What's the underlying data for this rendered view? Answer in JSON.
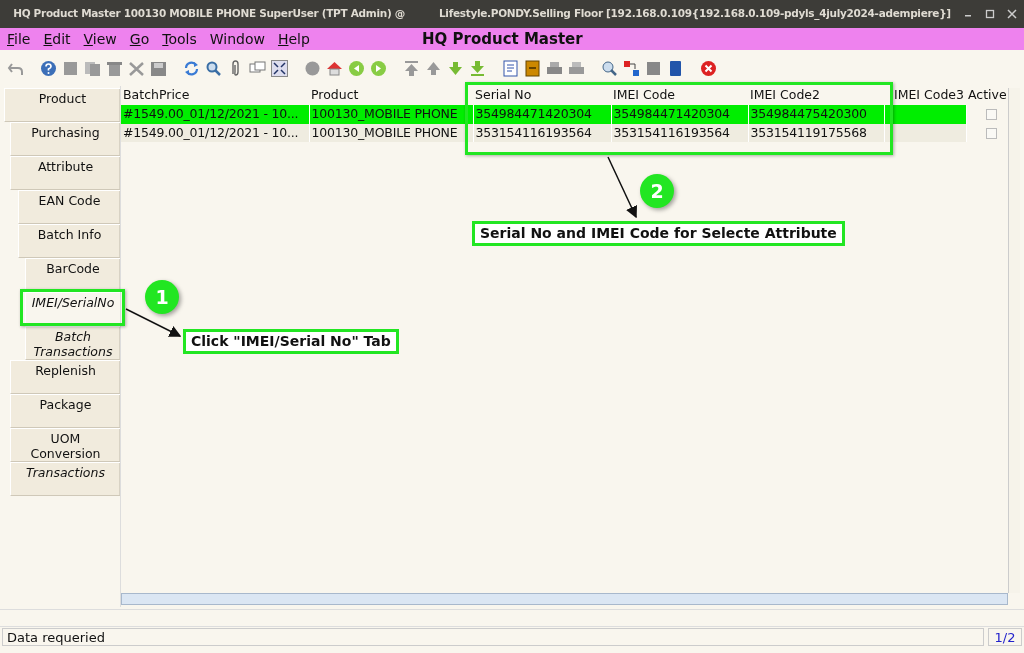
{
  "window": {
    "title_before": "HQ Product Master  100130  MOBILE PHONE  SuperUser (TPT Admin) @",
    "title_after": "Lifestyle.PONDY.Selling Floor [192.168.0.109{192.168.0.109-pdyls_4july2024-adempiere}]"
  },
  "menu": [
    {
      "label": "File",
      "mnemonic": true
    },
    {
      "label": "Edit",
      "mnemonic": true
    },
    {
      "label": "View",
      "mnemonic": true
    },
    {
      "label": "Go",
      "mnemonic": true
    },
    {
      "label": "Tools",
      "mnemonic": true
    },
    {
      "label": "Window",
      "mnemonic": false
    },
    {
      "label": "Help",
      "mnemonic": true
    }
  ],
  "menu_title": "HQ Product Master",
  "tabs": [
    {
      "label": "Product",
      "selected": false,
      "read_only": false,
      "children": [
        {
          "label": "Purchasing",
          "selected": false,
          "read_only": false
        },
        {
          "label": "Attribute",
          "selected": false,
          "read_only": false,
          "children": [
            {
              "label": "EAN Code",
              "selected": false,
              "read_only": false
            },
            {
              "label": "Batch Info",
              "selected": false,
              "read_only": false,
              "children": [
                {
                  "label": "BarCode",
                  "selected": false,
                  "read_only": false
                },
                {
                  "label": "IMEI/SerialNo",
                  "selected": true,
                  "read_only": true
                },
                {
                  "label": "Batch Transactions",
                  "selected": false,
                  "read_only": true
                }
              ]
            }
          ]
        },
        {
          "label": "Replenish",
          "selected": false,
          "read_only": false
        },
        {
          "label": "Package",
          "selected": false,
          "read_only": false
        },
        {
          "label": "UOM Conversion",
          "selected": false,
          "read_only": false
        },
        {
          "label": "Transactions",
          "selected": false,
          "read_only": true
        }
      ]
    }
  ],
  "table": {
    "columns": [
      "BatchPrice",
      "Product",
      "Serial No",
      "IMEI Code",
      "IMEI Code2",
      "IMEI Code3",
      "Active"
    ],
    "rows": [
      {
        "selected": true,
        "cells": [
          "#1549.00_01/12/2021 - 10...",
          "100130_MOBILE PHONE",
          "354984471420304",
          "354984471420304",
          "354984475420300"
        ],
        "active": false
      },
      {
        "selected": false,
        "cells": [
          "#1549.00_01/12/2021 - 10...",
          "100130_MOBILE PHONE",
          "353154116193564",
          "353154116193564",
          "353154119175568"
        ],
        "active": false
      }
    ]
  },
  "annotations": [
    {
      "number": "1",
      "text": "Click \"IMEI/Serial No\" Tab"
    },
    {
      "number": "2",
      "text": "Serial No and IMEI Code for Selecte Attribute"
    }
  ],
  "status_bar": {
    "message": "Data requeried",
    "record": "1/2"
  }
}
